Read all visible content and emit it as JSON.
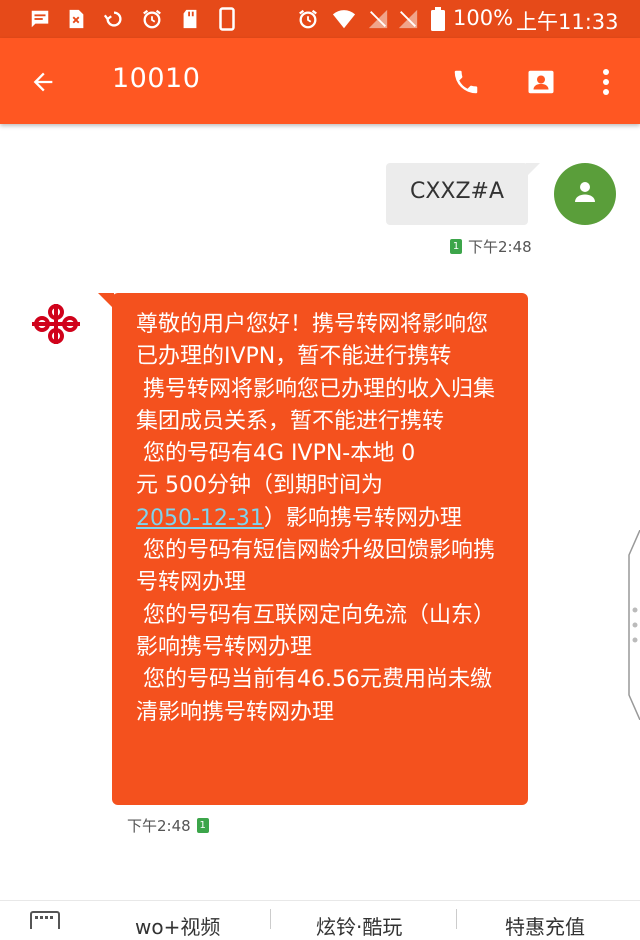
{
  "status_bar": {
    "battery_percent": "100%",
    "time": "上午11:33",
    "icons": [
      "message-icon",
      "sim-x-icon",
      "refresh-icon",
      "alarm-icon",
      "sd-card-icon",
      "phone-icon",
      "alarm-icon",
      "wifi-icon",
      "no-signal-icon",
      "no-signal-icon",
      "battery-icon"
    ]
  },
  "app_bar": {
    "title": "10010",
    "accent_color": "#ff5722"
  },
  "messages": {
    "outgoing": {
      "text": "CXXZ#A",
      "sim_badge": "1",
      "time": "下午2:48"
    },
    "incoming": {
      "text_part1": "尊敬的用户您好！携号转网将影响您已办理的IVPN，暂不能进行携转\n 携号转网将影响您已办理的收入归集集团成员关系，暂不能进行携转\n 您的号码有4G IVPN-本地 0\n元 500分钟（到期时间为\n",
      "link_date": "2050-12-31",
      "text_part2": "）影响携号转网办理\n 您的号码有短信网龄升级回馈影响携号转网办理\n 您的号码有互联网定向免流（山东）影响携号转网办理\n 您的号码当前有46.56元费用尚未缴清影响携号转网办理",
      "time": "下午2:48",
      "sim_badge": "1"
    }
  },
  "bottom_menu": {
    "items": [
      "wo+视频",
      "炫铃·酷玩",
      "特惠充值"
    ]
  }
}
